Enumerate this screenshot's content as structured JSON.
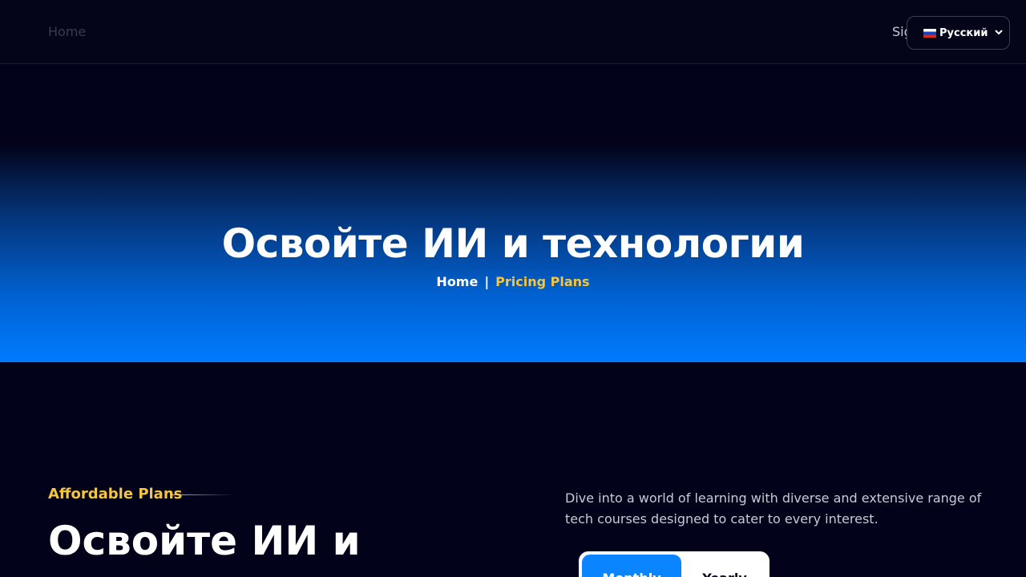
{
  "nav": {
    "home": "Home",
    "signin": "Sig",
    "language": {
      "selected": "Русский",
      "flag": "ru-flag-icon"
    }
  },
  "hero": {
    "title": "Освойте ИИ и технологии",
    "breadcrumb": {
      "home": "Home",
      "separator": "|",
      "current": "Pricing Plans"
    }
  },
  "pricing": {
    "tag": "Affordable Plans",
    "title": "Освойте ИИ и",
    "description": "Dive into a world of learning with diverse and extensive range of tech courses designed to cater to every interest.",
    "toggle": {
      "monthly": "Monthly",
      "yearly": "Yearly",
      "active": "Monthly"
    }
  },
  "colors": {
    "background": "#02031a",
    "accent": "#f5c542",
    "primary": "#0a84ff"
  }
}
